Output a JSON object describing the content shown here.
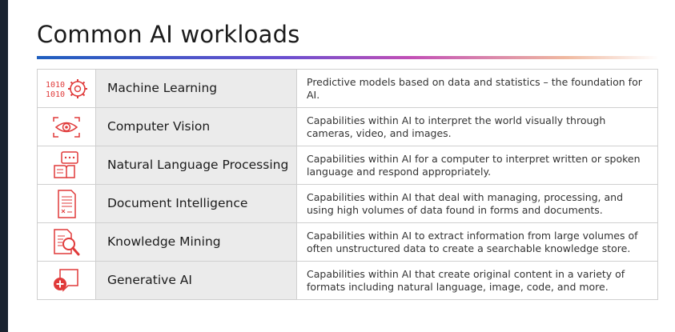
{
  "title": "Common AI workloads",
  "colors": {
    "accent": "#e03a3a",
    "row_label_bg": "#ebebeb"
  },
  "rows": [
    {
      "icon": "machine-learning-icon",
      "name": "Machine Learning",
      "description": "Predictive models based on data and statistics – the foundation for AI."
    },
    {
      "icon": "computer-vision-icon",
      "name": "Computer Vision",
      "description": "Capabilities within AI to interpret the world visually through cameras, video, and images."
    },
    {
      "icon": "natural-language-icon",
      "name": "Natural Language Processing",
      "description": "Capabilities within AI for a computer to interpret written or spoken language and respond appropriately."
    },
    {
      "icon": "document-intelligence-icon",
      "name": "Document Intelligence",
      "description": "Capabilities within AI that deal with managing, processing, and using high volumes of data found in forms and documents."
    },
    {
      "icon": "knowledge-mining-icon",
      "name": "Knowledge Mining",
      "description": "Capabilities within AI to extract information from large volumes of often unstructured data to create a searchable knowledge store."
    },
    {
      "icon": "generative-ai-icon",
      "name": "Generative AI",
      "description": "Capabilities within AI that create original content in a variety of formats including natural language, image, code, and more."
    }
  ]
}
